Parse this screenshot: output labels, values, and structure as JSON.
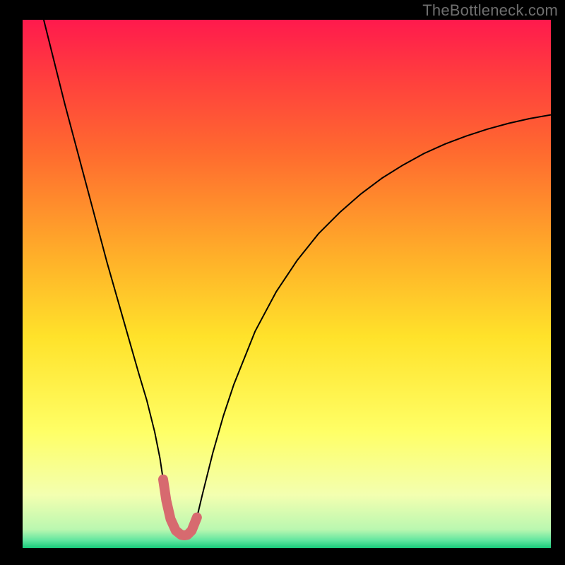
{
  "watermark": "TheBottleneck.com",
  "chart_data": {
    "type": "line",
    "title": "",
    "xlabel": "",
    "ylabel": "",
    "xlim": [
      0,
      100
    ],
    "ylim": [
      0,
      100
    ],
    "background_gradient": {
      "stops": [
        {
          "offset": 0.0,
          "color": "#ff1a4d"
        },
        {
          "offset": 0.1,
          "color": "#ff3b3f"
        },
        {
          "offset": 0.25,
          "color": "#ff6a2f"
        },
        {
          "offset": 0.45,
          "color": "#ffb029"
        },
        {
          "offset": 0.6,
          "color": "#ffe22a"
        },
        {
          "offset": 0.78,
          "color": "#ffff66"
        },
        {
          "offset": 0.9,
          "color": "#f3ffb0"
        },
        {
          "offset": 0.965,
          "color": "#baf7b0"
        },
        {
          "offset": 0.985,
          "color": "#63e6a0"
        },
        {
          "offset": 1.0,
          "color": "#18c97a"
        }
      ]
    },
    "series": [
      {
        "name": "bottleneck-curve",
        "color": "#000000",
        "stroke_width": 2,
        "x": [
          4,
          6,
          8,
          10,
          12,
          14,
          16,
          18,
          20,
          22,
          23.5,
          25,
          26,
          26.6,
          27.2,
          28,
          29,
          30,
          30.6,
          31.2,
          32,
          33,
          34,
          36,
          38,
          40,
          44,
          48,
          52,
          56,
          60,
          64,
          68,
          72,
          76,
          80,
          84,
          88,
          92,
          96,
          100
        ],
        "y": [
          100,
          92,
          84,
          76.5,
          69,
          61.5,
          54,
          47,
          40,
          33,
          28,
          22,
          17,
          13,
          9,
          5.5,
          3.3,
          2.5,
          2.4,
          2.5,
          3.3,
          5.8,
          10,
          18,
          25,
          31,
          41,
          48.5,
          54.5,
          59.5,
          63.5,
          67,
          70,
          72.5,
          74.7,
          76.5,
          78,
          79.3,
          80.4,
          81.3,
          82
        ]
      },
      {
        "name": "optimal-range-marker",
        "color": "#d76a6f",
        "stroke_width": 14,
        "linecap": "round",
        "x": [
          26.6,
          27.2,
          28,
          29,
          30,
          30.6,
          31.2,
          32,
          33
        ],
        "y": [
          13,
          9,
          5.5,
          3.3,
          2.5,
          2.4,
          2.5,
          3.3,
          5.8
        ]
      }
    ]
  }
}
